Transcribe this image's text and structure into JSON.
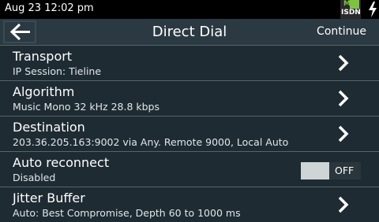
{
  "status_bar": {
    "time": "Aug 23 12:02 pm",
    "network_badge": {
      "top_label": "M",
      "bottom_label": "ISDN"
    },
    "power_icon": "charging-bolt-icon"
  },
  "header": {
    "back_icon": "arrow-left-icon",
    "title": "Direct Dial",
    "continue_label": "Continue"
  },
  "rows": [
    {
      "title": "Transport",
      "subtitle": "IP Session: Tieline",
      "icon": "chevron-right-icon"
    },
    {
      "title": "Algorithm",
      "subtitle": "Music Mono 32 kHz 28.8 kbps",
      "icon": "chevron-right-icon"
    },
    {
      "title": "Destination",
      "subtitle": "203.36.205.163:9002 via Any. Remote 9000, Local Auto",
      "icon": "chevron-right-icon"
    },
    {
      "title": "Auto reconnect",
      "subtitle": "Disabled",
      "toggle_label": "OFF",
      "toggle_on": false
    },
    {
      "title": "Jitter Buffer",
      "subtitle": "Auto: Best Compromise,  Depth 60 to 1000 ms",
      "icon": "chevron-right-icon"
    }
  ],
  "colors": {
    "background": "#1f2b33",
    "header": "#2b3942",
    "divider": "#56646c",
    "badge_green": "#7ec242"
  }
}
